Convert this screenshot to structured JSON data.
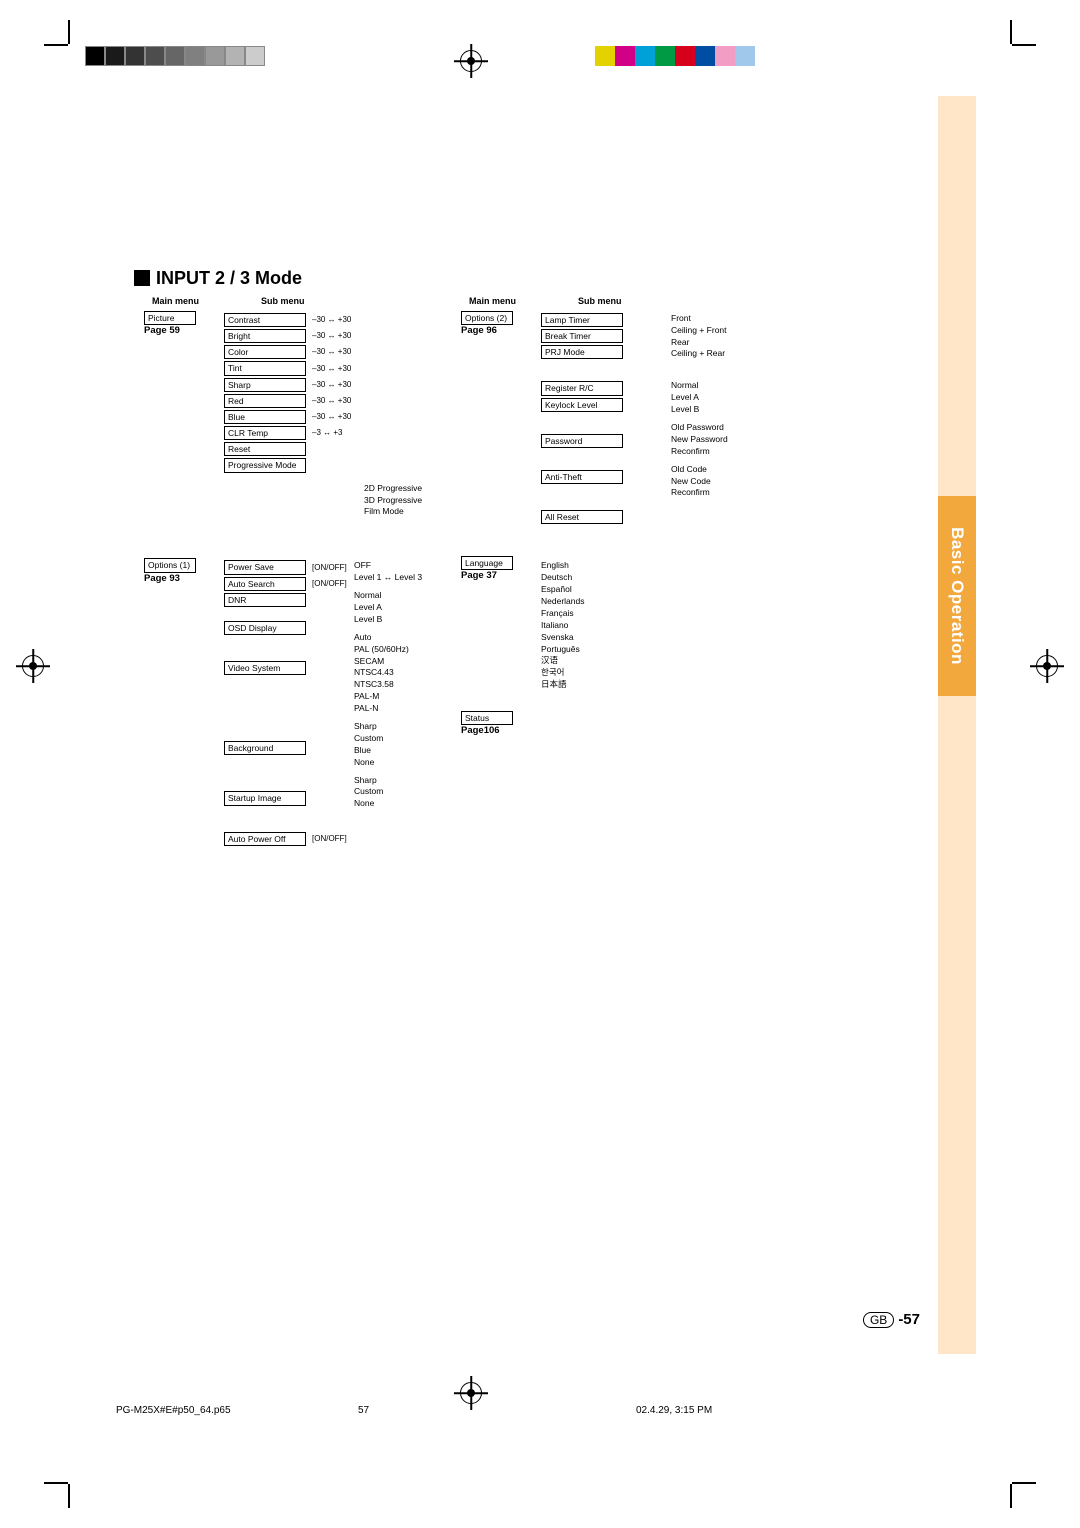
{
  "title": "INPUT 2 / 3 Mode",
  "side_tab": "Basic Operation",
  "labels": {
    "main_menu": "Main menu",
    "sub_menu": "Sub menu"
  },
  "page_refs": {
    "picture": "Page 59",
    "options1": "Page 93",
    "options2": "Page 96",
    "language": "Page 37",
    "status": "Page106"
  },
  "main_boxes": {
    "picture": "Picture",
    "options1": "Options (1)",
    "options2": "Options (2)",
    "language": "Language",
    "status": "Status"
  },
  "picture_sub": [
    {
      "name": "Contrast",
      "range": "–30 ↔ +30"
    },
    {
      "name": "Bright",
      "range": "–30 ↔ +30"
    },
    {
      "name": "Color",
      "range": "–30 ↔ +30"
    },
    {
      "name": "Tint",
      "range": "–30 ↔ +30"
    },
    {
      "name": "Sharp",
      "range": "–30 ↔ +30"
    },
    {
      "name": "Red",
      "range": "–30 ↔ +30"
    },
    {
      "name": "Blue",
      "range": "–30 ↔ +30"
    },
    {
      "name": "CLR Temp",
      "range": "–3 ↔ +3"
    },
    {
      "name": "Reset"
    },
    {
      "name": "Progressive Mode"
    }
  ],
  "progressive_modes": [
    "2D Progressive",
    "3D Progressive",
    "Film Mode"
  ],
  "options1_sub": [
    {
      "name": "Power Save",
      "value": "[ON/OFF]"
    },
    {
      "name": "Auto Search",
      "value": "[ON/OFF]"
    },
    {
      "name": "DNR"
    },
    {
      "name": "OSD Display"
    },
    {
      "name": "Video System"
    },
    {
      "name": "Background"
    },
    {
      "name": "Startup Image"
    },
    {
      "name": "Auto Power Off",
      "value": "[ON/OFF]"
    }
  ],
  "dnr_opts": [
    "OFF",
    "Level 1 ↔ Level 3"
  ],
  "osd_opts": [
    "Normal",
    "Level A",
    "Level B"
  ],
  "video_opts": [
    "Auto",
    "PAL (50/60Hz)",
    "SECAM",
    "NTSC4.43",
    "NTSC3.58",
    "PAL-M",
    "PAL-N"
  ],
  "background_opts": [
    "Sharp",
    "Custom",
    "Blue",
    "None"
  ],
  "startup_opts": [
    "Sharp",
    "Custom",
    "None"
  ],
  "options2_sub": [
    {
      "name": "Lamp Timer"
    },
    {
      "name": "Break Timer"
    },
    {
      "name": "PRJ Mode"
    },
    {
      "name": "Register R/C"
    },
    {
      "name": "Keylock Level"
    },
    {
      "name": "Password"
    },
    {
      "name": "Anti-Theft"
    },
    {
      "name": "All Reset"
    }
  ],
  "prj_opts": [
    "Front",
    "Ceiling + Front",
    "Rear",
    "Ceiling + Rear"
  ],
  "keylock_opts": [
    "Normal",
    "Level A",
    "Level B"
  ],
  "password_opts": [
    "Old Password",
    "New Password",
    "Reconfirm"
  ],
  "antitheft_opts": [
    "Old Code",
    "New Code",
    "Reconfirm"
  ],
  "languages": [
    "English",
    "Deutsch",
    "Español",
    "Nederlands",
    "Français",
    "Italiano",
    "Svenska",
    "Português",
    "汉语",
    "한국어",
    "日本語"
  ],
  "page_number": {
    "region": "GB",
    "num": "-57"
  },
  "footer": {
    "file": "PG-M25X#E#p50_64.p65",
    "page_print": "57",
    "timestamp": "02.4.29, 3:15 PM"
  },
  "color_bars_left": [
    "#000",
    "#1a1a1a",
    "#333",
    "#4d4d4d",
    "#666",
    "#808080",
    "#999",
    "#b3b3b3",
    "#ccc"
  ],
  "color_bars_right": [
    "#e3d200",
    "#d10086",
    "#00a0d8",
    "#009944",
    "#d6001c",
    "#004ea2",
    "#f29ec4",
    "#9fc8eb"
  ]
}
